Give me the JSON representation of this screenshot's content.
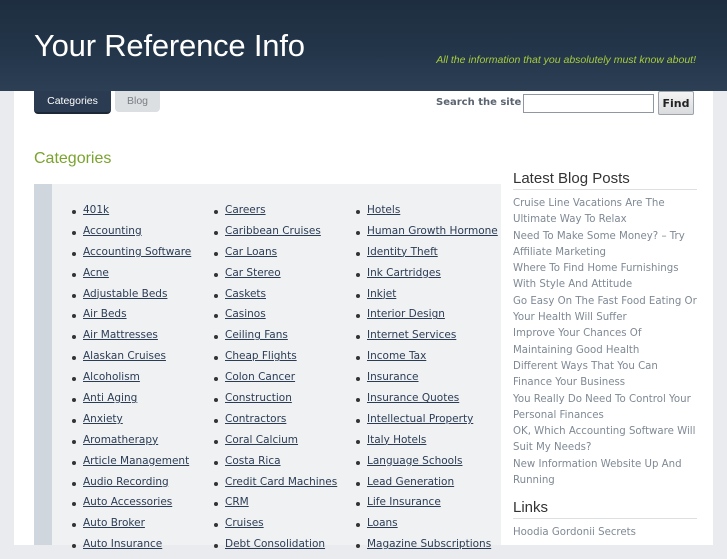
{
  "header": {
    "title": "Your Reference Info",
    "tagline": "All the information that you absolutely must know about!"
  },
  "nav": {
    "tabs": [
      {
        "label": "Categories",
        "active": true
      },
      {
        "label": "Blog",
        "active": false
      }
    ]
  },
  "search": {
    "label": "Search the site",
    "value": "",
    "button": "Find"
  },
  "main": {
    "heading": "Categories",
    "columns": [
      [
        "401k",
        "Accounting",
        "Accounting Software",
        "Acne",
        "Adjustable Beds",
        "Air Beds",
        "Air Mattresses",
        "Alaskan Cruises",
        "Alcoholism",
        "Anti Aging",
        "Anxiety",
        "Aromatherapy",
        "Article Management",
        "Audio Recording",
        "Auto Accessories",
        "Auto Broker",
        "Auto Insurance"
      ],
      [
        "Careers",
        "Caribbean Cruises",
        "Car Loans",
        "Car Stereo",
        "Caskets",
        "Casinos",
        "Ceiling Fans",
        "Cheap Flights",
        "Colon Cancer",
        "Construction",
        "Contractors",
        "Coral Calcium",
        "Costa Rica",
        "Credit Card Machines",
        "CRM",
        "Cruises",
        "Debt Consolidation"
      ],
      [
        "Hotels",
        "Human Growth Hormone",
        "Identity Theft",
        "Ink Cartridges",
        "Inkjet",
        "Interior Design",
        "Internet Services",
        "Income Tax",
        "Insurance",
        "Insurance Quotes",
        "Intellectual Property",
        "Italy Hotels",
        "Language Schools",
        "Lead Generation",
        "Life Insurance",
        "Loans",
        "Magazine Subscriptions"
      ]
    ]
  },
  "sidebar": {
    "latest_heading": "Latest Blog Posts",
    "posts": [
      "Cruise Line Vacations Are The Ultimate Way To Relax",
      "Need To Make Some Money? – Try Affiliate Marketing",
      "Where To Find Home Furnishings With Style And Attitude",
      "Go Easy On The Fast Food Eating Or Your Health Will Suffer",
      "Improve Your Chances Of Maintaining Good Health",
      "Different Ways That You Can Finance Your Business",
      "You Really Do Need To Control Your Personal Finances",
      "OK, Which Accounting Software Will Suit My Needs?",
      "New Information Website Up And Running"
    ],
    "links_heading": "Links",
    "links": [
      "Hoodia Gordonii Secrets"
    ]
  }
}
